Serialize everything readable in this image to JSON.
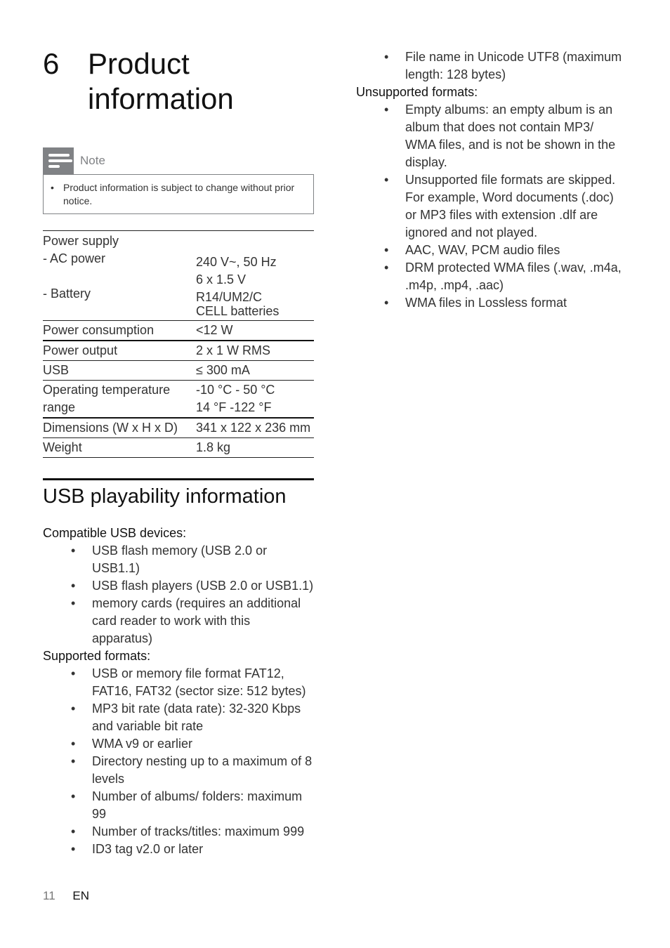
{
  "chapter": {
    "number": "6",
    "title": "Product information"
  },
  "note": {
    "label": "Note",
    "icon": "note-lines-icon",
    "items": [
      "Product information is subject to change without prior notice."
    ]
  },
  "spec_table": {
    "power_supply": {
      "label": "Power supply",
      "ac_label": "- AC power",
      "ac_value": "240 V~, 50 Hz",
      "battery_label": "- Battery",
      "battery_value_line1": "6 x 1.5 V R14/UM2/C",
      "battery_value_line2": "CELL batteries"
    },
    "rows": [
      {
        "label": "Power consumption",
        "value": "<12 W"
      },
      {
        "label": "Power output",
        "value": "2 x 1 W RMS"
      },
      {
        "label": "USB",
        "value": "≤  300 mA"
      },
      {
        "label": "Operating temperature range",
        "value": "-10 °C - 50 °C\n14 °F -122 °F"
      },
      {
        "label": "Dimensions (W x H x D)",
        "value": "341 x 122 x 236 mm"
      },
      {
        "label": "Weight",
        "value": "1.8 kg"
      }
    ]
  },
  "usb_section": {
    "title": "USB playability information",
    "compatible_heading": "Compatible USB devices:",
    "compatible": [
      "USB flash memory (USB 2.0 or USB1.1)",
      "USB flash players (USB 2.0 or USB1.1)",
      "memory cards (requires an additional card reader to work with this apparatus)"
    ],
    "supported_heading": "Supported formats:",
    "supported": [
      "USB or memory file format FAT12, FAT16, FAT32 (sector size: 512 bytes)",
      "MP3 bit rate (data rate): 32-320 Kbps and variable bit rate",
      "WMA v9 or earlier",
      "Directory nesting up to a maximum of 8 levels",
      "Number of albums/ folders: maximum 99",
      "Number of tracks/titles: maximum 999",
      "ID3 tag v2.0 or later",
      "File name in Unicode UTF8 (maximum length: 128 bytes)"
    ],
    "unsupported_heading": "Unsupported formats:",
    "unsupported": [
      "Empty albums: an empty album is an album that does not contain MP3/ WMA files, and is not be shown in the display.",
      "Unsupported file formats are skipped. For example, Word documents (.doc) or MP3 files with extension .dlf are ignored and not played.",
      "AAC, WAV, PCM audio files",
      "DRM protected WMA files (.wav, .m4a, .m4p, .mp4, .aac)",
      "WMA files in Lossless format"
    ]
  },
  "footer": {
    "page_number": "11",
    "language": "EN"
  }
}
